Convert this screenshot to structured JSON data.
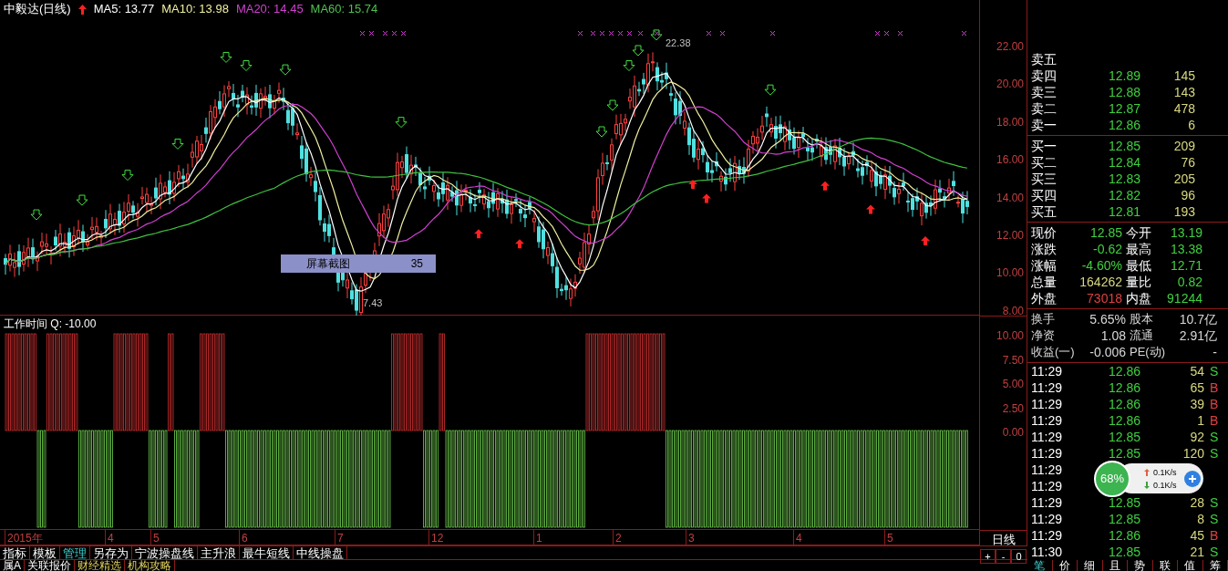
{
  "header": {
    "title": "中毅达(日线)",
    "indicators": [
      {
        "label": "MA5: 13.77",
        "color": "#ffffff"
      },
      {
        "label": "MA10: 13.98",
        "color": "#f0f0a0"
      },
      {
        "label": "MA20: 14.45",
        "color": "#d040d0"
      },
      {
        "label": "MA60: 15.74",
        "color": "#50c050"
      }
    ]
  },
  "chart": {
    "high_label": "22.38",
    "low_label": "7.43",
    "tooltip": {
      "label": "屏幕截图",
      "value": "35"
    }
  },
  "price_axis": {
    "ticks": [
      "22.00",
      "20.00",
      "18.00",
      "16.00",
      "14.00",
      "12.00",
      "10.00",
      "8.00"
    ]
  },
  "oscillator": {
    "title": "工作时间 Q: -10.00",
    "ticks": [
      "10.00",
      "7.50",
      "5.00",
      "2.50",
      "0.00"
    ]
  },
  "date_axis": [
    "2015年",
    "4",
    "5",
    "6",
    "7",
    "12",
    "1",
    "2",
    "3",
    "4",
    "5"
  ],
  "period": {
    "label": "日线",
    "buttons": [
      "+",
      "-",
      "0"
    ]
  },
  "toolbar": [
    {
      "label": "指标",
      "selected": false
    },
    {
      "label": "模板",
      "selected": false
    },
    {
      "label": "管理",
      "selected": true
    },
    {
      "label": "另存为",
      "selected": false
    },
    {
      "label": "宁波操盘线",
      "selected": false
    },
    {
      "label": "主升浪",
      "selected": false
    },
    {
      "label": "最牛短线",
      "selected": false
    },
    {
      "label": "中线操盘",
      "selected": false
    }
  ],
  "bottom_tabs": [
    {
      "label": "属A",
      "highlight": false
    },
    {
      "label": "关联报价",
      "highlight": false
    },
    {
      "label": "财经精选",
      "highlight": true
    },
    {
      "label": "机构攻略",
      "highlight": true
    }
  ],
  "order_book": {
    "asks": [
      {
        "label": "卖五"
      },
      {
        "label": "卖四",
        "price": "12.89",
        "volume": "145"
      },
      {
        "label": "卖三",
        "price": "12.88",
        "volume": "143"
      },
      {
        "label": "卖二",
        "price": "12.87",
        "volume": "478"
      },
      {
        "label": "卖一",
        "price": "12.86",
        "volume": "6"
      }
    ],
    "bids": [
      {
        "label": "买一",
        "price": "12.85",
        "volume": "209"
      },
      {
        "label": "买二",
        "price": "12.84",
        "volume": "76"
      },
      {
        "label": "买三",
        "price": "12.83",
        "volume": "205"
      },
      {
        "label": "买四",
        "price": "12.82",
        "volume": "96"
      },
      {
        "label": "买五",
        "price": "12.81",
        "volume": "193"
      }
    ]
  },
  "quotes": [
    {
      "label": "现价",
      "value": "12.85",
      "color": "#40d040",
      "label2": "今开",
      "value2": "13.19"
    },
    {
      "label": "涨跌",
      "value": "-0.62",
      "color": "#40d040",
      "label2": "最高",
      "value2": "13.38"
    },
    {
      "label": "涨幅",
      "value": "-4.60%",
      "color": "#40d040",
      "label2": "最低",
      "value2": "12.71"
    },
    {
      "label": "总量",
      "value": "164262",
      "color": "#d8d880",
      "label2": "量比",
      "value2": "0.82"
    },
    {
      "label": "外盘",
      "value": "73018",
      "color": "#e04040",
      "label2": "内盘",
      "value2": "91244"
    }
  ],
  "stats": [
    {
      "label": "换手",
      "value": "5.65%",
      "label2": "股本",
      "value2": "10.7亿"
    },
    {
      "label": "净资",
      "value": "1.08",
      "label2": "流通",
      "value2": "2.91亿"
    },
    {
      "label": "收益(一)",
      "value": "-0.006",
      "label2": "PE(动)",
      "value2": "-"
    }
  ],
  "trades": [
    {
      "time": "11:29",
      "price": "12.86",
      "volume": "54",
      "side": "S",
      "kind": "sell"
    },
    {
      "time": "11:29",
      "price": "12.86",
      "volume": "65",
      "side": "B",
      "kind": "buy"
    },
    {
      "time": "11:29",
      "price": "12.86",
      "volume": "39",
      "side": "B",
      "kind": "buy"
    },
    {
      "time": "11:29",
      "price": "12.86",
      "volume": "1",
      "side": "B",
      "kind": "buy"
    },
    {
      "time": "11:29",
      "price": "12.85",
      "volume": "92",
      "side": "S",
      "kind": "sell"
    },
    {
      "time": "11:29",
      "price": "12.85",
      "volume": "120",
      "side": "S",
      "kind": "sell"
    },
    {
      "time": "11:29"
    },
    {
      "time": "11:29"
    },
    {
      "time": "11:29",
      "price": "12.85",
      "volume": "28",
      "side": "S",
      "kind": "sell"
    },
    {
      "time": "11:29",
      "price": "12.85",
      "volume": "8",
      "side": "S",
      "kind": "sell"
    },
    {
      "time": "11:29",
      "price": "12.86",
      "volume": "45",
      "side": "B",
      "kind": "buy"
    },
    {
      "time": "11:30",
      "price": "12.85",
      "volume": "21",
      "side": "S",
      "kind": "sell"
    }
  ],
  "side_tabs": [
    {
      "label": "笔",
      "selected": true
    },
    {
      "label": "价",
      "selected": false
    },
    {
      "label": "细",
      "selected": false
    },
    {
      "label": "且",
      "selected": false
    },
    {
      "label": "势",
      "selected": false
    },
    {
      "label": "联",
      "selected": false
    },
    {
      "label": "值",
      "selected": false
    },
    {
      "label": "筹",
      "selected": false
    }
  ],
  "net_widget": {
    "percent": "68%",
    "upload": "0.1K/s",
    "download": "0.1K/s"
  }
}
